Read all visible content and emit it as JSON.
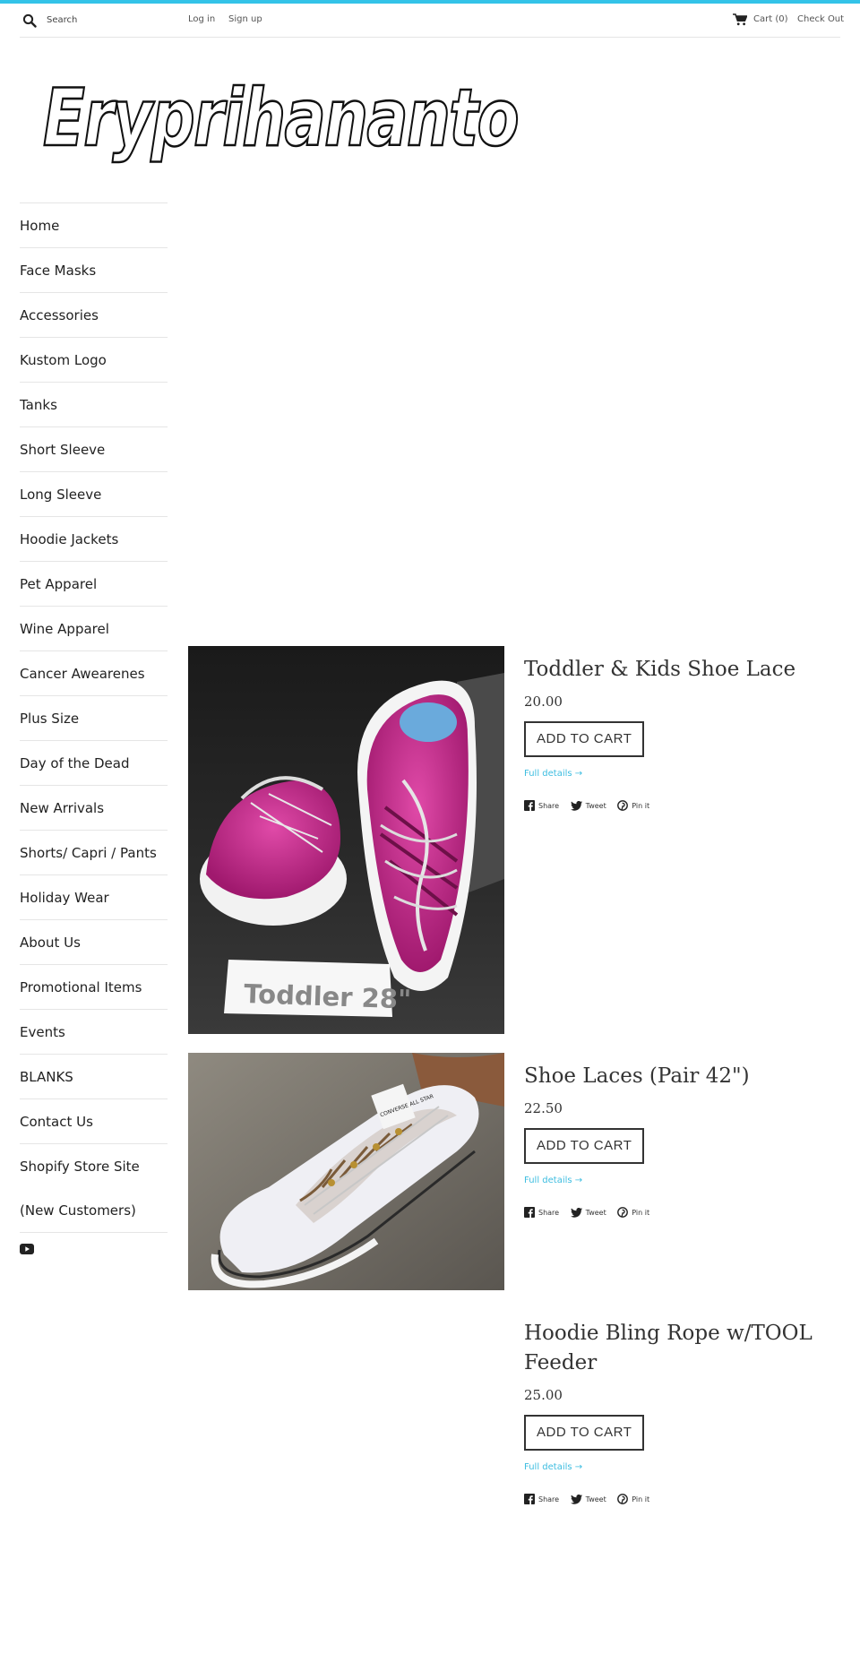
{
  "header": {
    "search_placeholder": "Search",
    "login": "Log in",
    "signup": "Sign up",
    "cart": "Cart (0)",
    "checkout": "Check Out"
  },
  "brand": {
    "logo_text": "Eryprihananto"
  },
  "sidebar": {
    "items": [
      {
        "label": "Home"
      },
      {
        "label": "Face Masks"
      },
      {
        "label": "Accessories"
      },
      {
        "label": "Kustom Logo"
      },
      {
        "label": "Tanks"
      },
      {
        "label": "Short Sleeve"
      },
      {
        "label": "Long Sleeve"
      },
      {
        "label": "Hoodie Jackets"
      },
      {
        "label": "Pet Apparel"
      },
      {
        "label": "Wine Apparel"
      },
      {
        "label": "Cancer Awearenes"
      },
      {
        "label": "Plus Size"
      },
      {
        "label": "Day of the Dead"
      },
      {
        "label": "New Arrivals"
      },
      {
        "label": "Shorts/ Capri / Pants"
      },
      {
        "label": "Holiday Wear"
      },
      {
        "label": "About Us"
      },
      {
        "label": "Promotional Items"
      },
      {
        "label": "Events"
      },
      {
        "label": "BLANKS"
      },
      {
        "label": "Contact Us"
      },
      {
        "label": "Shopify Store Site"
      },
      {
        "label": "(New Customers)"
      }
    ],
    "social_icon": "youtube-icon"
  },
  "products": [
    {
      "title": "Toddler & Kids Shoe Lace",
      "price": "20.00",
      "add_to_cart": "ADD TO CART",
      "details": "Full details →",
      "image_caption": "Toddler 28\""
    },
    {
      "title": "Shoe Laces (Pair 42\")",
      "price": "22.50",
      "add_to_cart": "ADD TO CART",
      "details": "Full details →",
      "image_badge": "CONVERSE ALL STAR"
    },
    {
      "title": "Hoodie Bling Rope w/TOOL Feeder",
      "price": "25.00",
      "add_to_cart": "ADD TO CART",
      "details": "Full details →"
    }
  ],
  "social": {
    "share": "Share",
    "tweet": "Tweet",
    "pin": "Pin it"
  },
  "colors": {
    "accent": "#33c3e8",
    "link": "#3dbde0",
    "text": "#333333"
  }
}
